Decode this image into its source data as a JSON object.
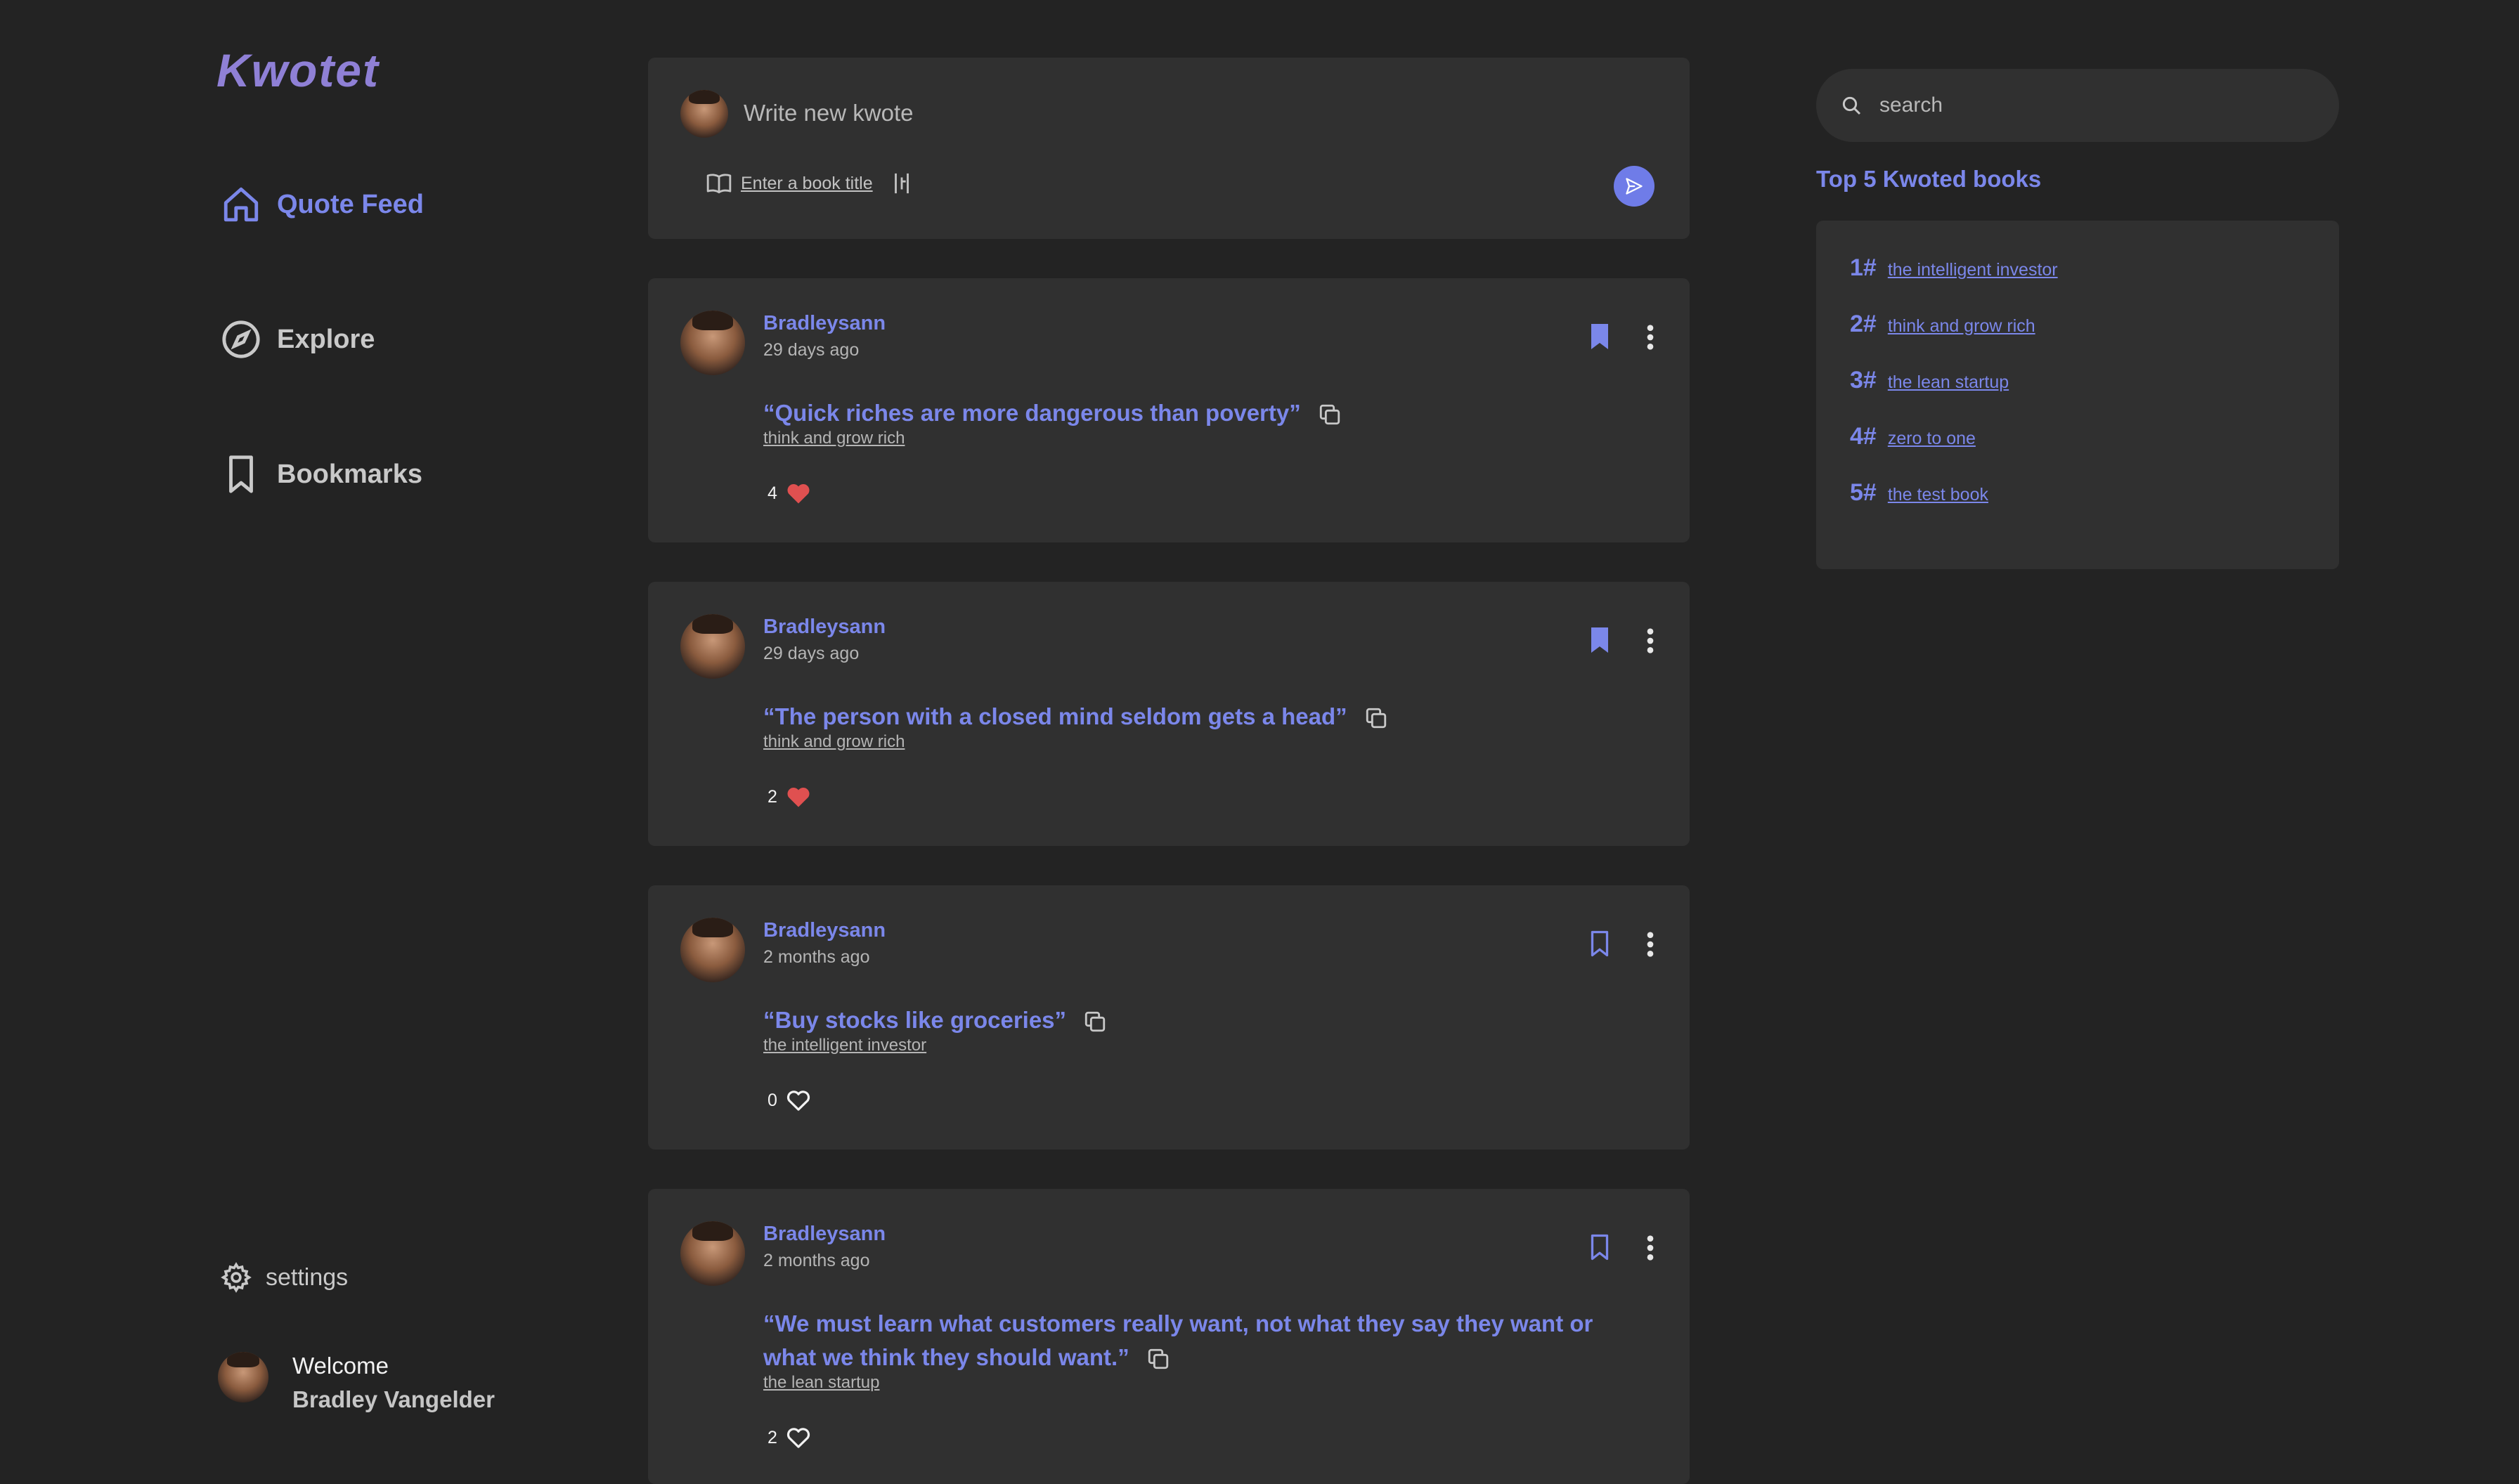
{
  "app": {
    "logo": "Kwotet"
  },
  "sidebar": {
    "items": [
      {
        "label": "Quote Feed",
        "icon": "home-icon",
        "active": true
      },
      {
        "label": "Explore",
        "icon": "compass-icon",
        "active": false
      },
      {
        "label": "Bookmarks",
        "icon": "bookmark-icon",
        "active": false
      }
    ],
    "settings_label": "settings",
    "welcome_label": "Welcome",
    "user_name": "Bradley Vangelder"
  },
  "composer": {
    "placeholder": "Write new kwote",
    "book_link": "Enter a book title"
  },
  "posts": [
    {
      "author": "Bradleysann",
      "time": "29 days ago",
      "quote": "Quick riches are more dangerous than poverty",
      "book": "think and grow rich",
      "likes": "4",
      "liked": true,
      "bookmarked": true
    },
    {
      "author": "Bradleysann",
      "time": "29 days ago",
      "quote": "The person with a closed mind seldom gets a head",
      "book": "think and grow rich",
      "likes": "2",
      "liked": true,
      "bookmarked": true
    },
    {
      "author": "Bradleysann",
      "time": "2 months ago",
      "quote": "Buy stocks like groceries",
      "book": "the intelligent investor",
      "likes": "0",
      "liked": false,
      "bookmarked": false
    },
    {
      "author": "Bradleysann",
      "time": "2 months ago",
      "quote": "We must learn what customers really want, not what they say they want or what we think they should want.",
      "book": "the lean startup",
      "likes": "2",
      "liked": false,
      "bookmarked": false
    }
  ],
  "search": {
    "placeholder": "search"
  },
  "top_books": {
    "title": "Top 5 Kwoted books",
    "items": [
      {
        "rank": "1#",
        "title": "the intelligent investor"
      },
      {
        "rank": "2#",
        "title": "think and grow rich"
      },
      {
        "rank": "3#",
        "title": "the lean startup"
      },
      {
        "rank": "4#",
        "title": "zero to one"
      },
      {
        "rank": "5#",
        "title": "the test book"
      }
    ]
  },
  "colors": {
    "accent": "#7b87ea",
    "background": "#232323",
    "card": "#303030",
    "heart": "#e05050"
  }
}
